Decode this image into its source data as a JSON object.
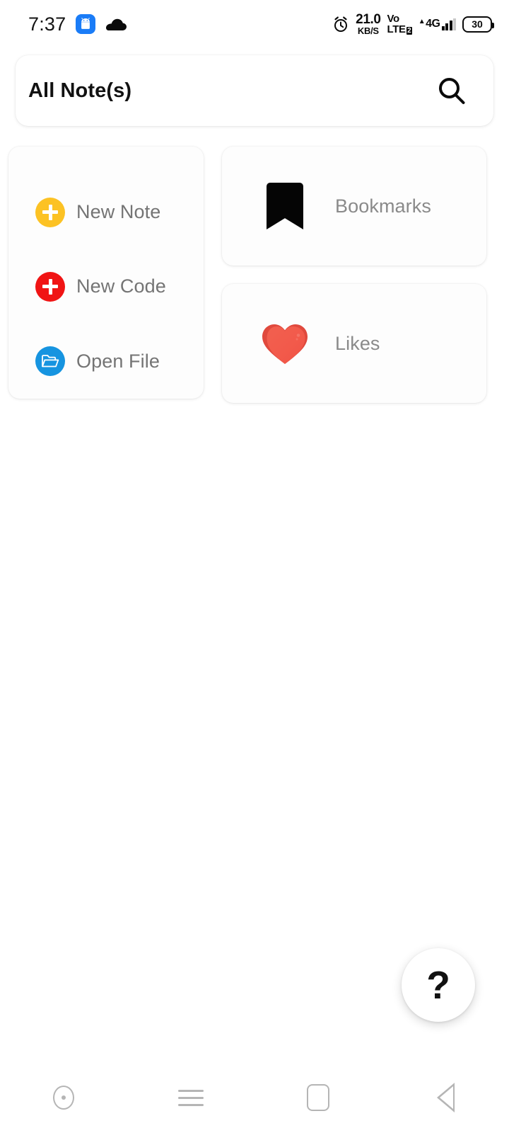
{
  "status_bar": {
    "time": "7:37",
    "android_icon": "android-robot-icon",
    "cloud_icon": "cloud-icon",
    "alarm_icon": "alarm-clock-icon",
    "network_speed_value": "21.0",
    "network_speed_unit": "KB/S",
    "volte_top": "Vo",
    "volte_bottom": "LTE",
    "volte_sim": "2",
    "network_type": "4G",
    "signal_icon": "signal-bars-icon",
    "battery_level": "30"
  },
  "header": {
    "title": "All Note(s)",
    "search_icon": "search-icon"
  },
  "actions": {
    "items": [
      {
        "label": "New Note",
        "icon": "plus-icon",
        "color": "#fcc224"
      },
      {
        "label": "New Code",
        "icon": "plus-icon",
        "color": "#f01414"
      },
      {
        "label": "Open File",
        "icon": "open-folder-icon",
        "color": "#1694e0"
      }
    ]
  },
  "tiles": [
    {
      "label": "Bookmarks",
      "icon": "bookmark-icon",
      "color": "#050505"
    },
    {
      "label": "Likes",
      "icon": "heart-icon",
      "color": "#f0594c"
    }
  ],
  "fab": {
    "label": "?",
    "icon": "question-mark-icon"
  },
  "navbar": {
    "items": [
      {
        "name": "screen-record",
        "icon": "circle-dot-icon"
      },
      {
        "name": "menu",
        "icon": "hamburger-menu-icon"
      },
      {
        "name": "home",
        "icon": "square-home-icon"
      },
      {
        "name": "back",
        "icon": "back-triangle-icon"
      }
    ]
  }
}
